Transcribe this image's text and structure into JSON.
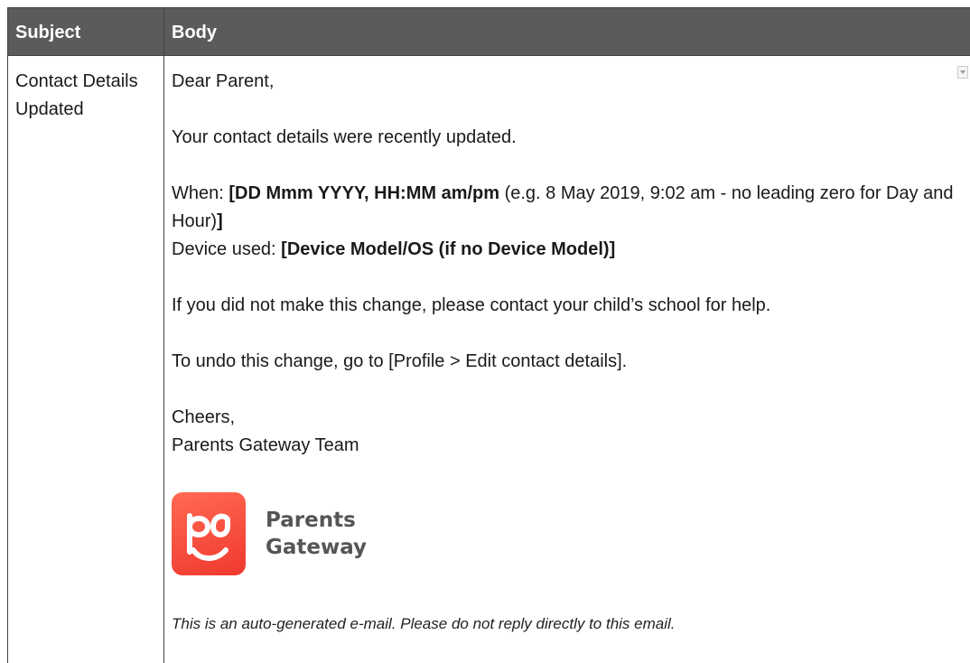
{
  "table": {
    "headers": {
      "subject": "Subject",
      "body": "Body"
    },
    "subject": {
      "line1": "Contact Details",
      "line2": "Updated"
    }
  },
  "email": {
    "greeting": "Dear Parent,",
    "intro": "Your contact details were recently updated.",
    "when_label": "When: ",
    "when_value_bold": "[DD Mmm YYYY, HH:MM am/pm",
    "when_note": " (e.g. 8 May 2019, 9:02 am - no leading zero for Day and Hour)",
    "when_close_bold": "]",
    "device_label": "Device used: ",
    "device_value_bold": "[Device Model/OS (if no Device Model)]",
    "contact_school": "If you did not make this change, please contact your child’s school for help.",
    "undo": "To undo this change, go to [Profile > Edit contact details].",
    "signoff": "Cheers,",
    "team": "Parents Gateway Team",
    "logo_line1": "Parents",
    "logo_line2": "Gateway",
    "footer": "This is an auto-generated e-mail. Please do not reply directly to this email."
  },
  "colors": {
    "header_bg": "#5b5b5b",
    "logo_bg": "#f0382f"
  },
  "icons": {
    "logo": "parents-gateway-logo-icon",
    "scroll": "scroll-arrow-icon"
  }
}
